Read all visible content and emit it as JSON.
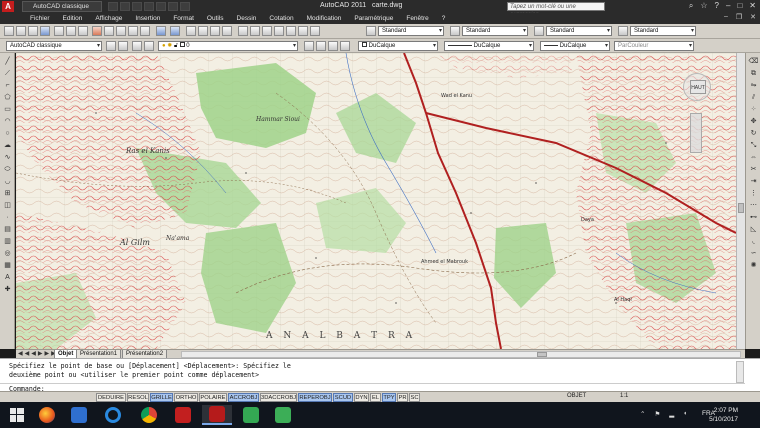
{
  "window": {
    "title": "AutoCAD 2011",
    "title_file": "carte.dwg",
    "workspace": "AutoCAD classique",
    "search_placeholder": "Tapez un mot-clé ou une expression"
  },
  "menu": [
    "Fichier",
    "Edition",
    "Affichage",
    "Insertion",
    "Format",
    "Outils",
    "Dessin",
    "Cotation",
    "Modification",
    "Paramétrique",
    "Fenêtre",
    "?"
  ],
  "toolbar": {
    "workspace_combo": "AutoCAD classique",
    "layer_combo": "0",
    "text_style": "Standard",
    "dim_style": "Standard",
    "table_style": "Standard",
    "mleader_style": "Standard",
    "color_combo": "DuCalque",
    "linetype_combo": "DuCalque",
    "lineweight_combo": "DuCalque",
    "plotstyle_combo": "ParCouleur"
  },
  "map": {
    "labels": [
      {
        "text": "Hammar Sioui"
      },
      {
        "text": "Ras el Kanis"
      },
      {
        "text": "Al Gilm"
      },
      {
        "text": "Na'ama"
      },
      {
        "text": "Wad el Kanu"
      },
      {
        "text": "Ahmed el Mabrouk"
      },
      {
        "text": "A N A L   B A T R A"
      },
      {
        "text": "Daya"
      },
      {
        "text": "Al Haql"
      }
    ],
    "viewcube_label": "HAUT"
  },
  "layout_tabs": [
    "Objet",
    "Présentation1",
    "Présentation2"
  ],
  "layout_tab_active": "Objet",
  "command": {
    "history_line1": "Spécifiez le point de base ou [Déplacement] <Déplacement>: Spécifiez le",
    "history_line2": "deuxième point ou <utiliser le premier point comme déplacement>",
    "prompt": "Commande:"
  },
  "status": {
    "buttons": [
      {
        "label": "DEDUIRE",
        "on": false
      },
      {
        "label": "RESOL",
        "on": false
      },
      {
        "label": "GRILLE",
        "on": true
      },
      {
        "label": "ORTHO",
        "on": false
      },
      {
        "label": "POLAIRE",
        "on": false
      },
      {
        "label": "ACCROBJ",
        "on": true
      },
      {
        "label": "3DACCROBJ",
        "on": false
      },
      {
        "label": "REPEROBJ",
        "on": true
      },
      {
        "label": "SCUD",
        "on": true
      },
      {
        "label": "DYN",
        "on": false
      },
      {
        "label": "EL",
        "on": false
      },
      {
        "label": "TPY",
        "on": true
      },
      {
        "label": "PR",
        "on": false
      },
      {
        "label": "SC",
        "on": false
      }
    ],
    "model_label": "OBJET",
    "scale": "1:1"
  },
  "taskbar": {
    "apps": [
      "windows-start",
      "firefox",
      "mail",
      "internet-explorer",
      "chrome",
      "adobe-acrobat",
      "autocad",
      "camtasia",
      "camtasia-recorder"
    ],
    "active_app": "autocad",
    "lang": "FRA",
    "time": "2:07 PM",
    "date": "5/10/2017"
  }
}
